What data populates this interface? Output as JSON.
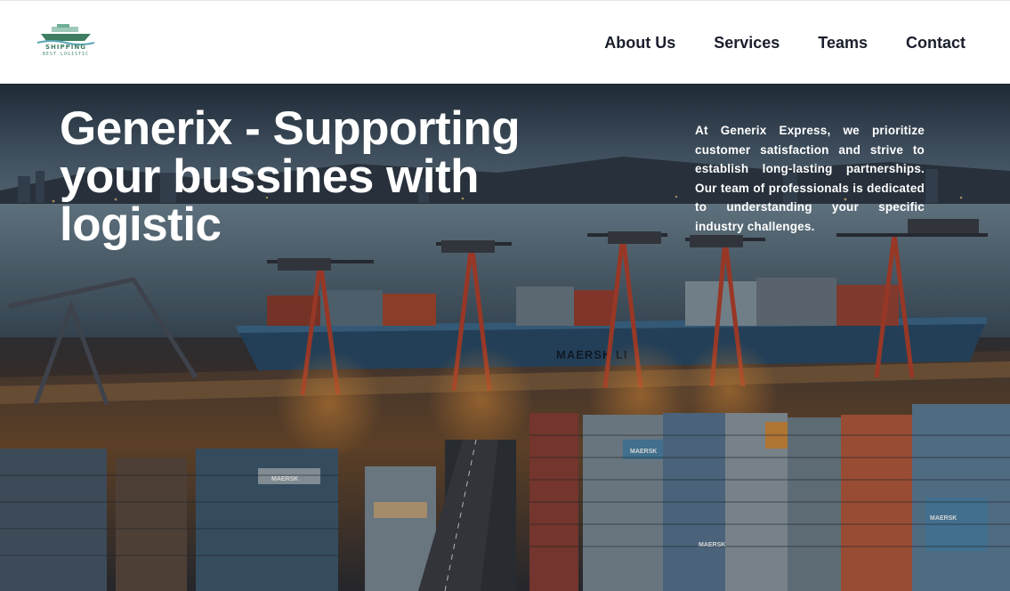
{
  "brand": {
    "logo_text": "SHIPPING",
    "logo_subtext": "BEST LOGISTIC"
  },
  "nav": {
    "items": [
      {
        "label": "About Us"
      },
      {
        "label": "Services"
      },
      {
        "label": "Teams"
      },
      {
        "label": "Contact"
      }
    ]
  },
  "hero": {
    "title": "Generix - Supporting your bussines with logistic",
    "description": "At Generix Express, we prioritize customer satisfaction and strive to establish long-lasting partnerships. Our team of professionals is dedicated to understanding your specific industry challenges.",
    "background_image": "container-port-night",
    "ship_hull_text": "MAERSK LI",
    "container_brand": "MAERSK"
  },
  "colors": {
    "nav_text": "#1a1f2c",
    "hero_text": "#ffffff",
    "logo_green": "#3f7e62",
    "container_blue": "#4d84a8",
    "crane_red": "#b8402a",
    "dock_light": "#e8812f"
  }
}
